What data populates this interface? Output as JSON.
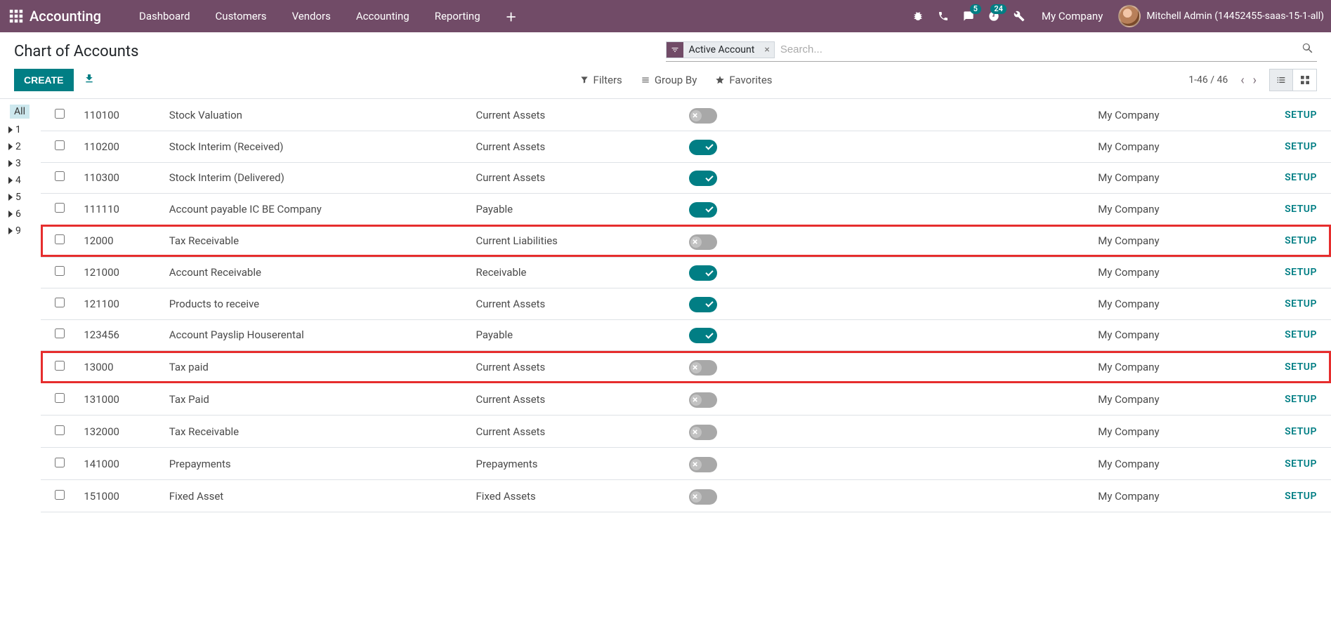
{
  "nav": {
    "app_title": "Accounting",
    "items": [
      "Dashboard",
      "Customers",
      "Vendors",
      "Accounting",
      "Reporting"
    ],
    "badges": {
      "messages": "5",
      "activities": "24"
    },
    "company": "My Company",
    "user": "Mitchell Admin (14452455-saas-15-1-all)"
  },
  "cp": {
    "title": "Chart of Accounts",
    "search_facet": "Active Account",
    "search_placeholder": "Search...",
    "create": "CREATE",
    "filters": "Filters",
    "groupby": "Group By",
    "favorites": "Favorites",
    "pager": "1-46 / 46"
  },
  "tree": {
    "all": "All",
    "nodes": [
      "1",
      "2",
      "3",
      "4",
      "5",
      "6",
      "9"
    ]
  },
  "table": {
    "setup_label": "SETUP",
    "rows": [
      {
        "code": "110100",
        "name": "Stock Valuation",
        "type": "Current Assets",
        "on": false,
        "company": "My Company",
        "hl": false
      },
      {
        "code": "110200",
        "name": "Stock Interim (Received)",
        "type": "Current Assets",
        "on": true,
        "company": "My Company",
        "hl": false
      },
      {
        "code": "110300",
        "name": "Stock Interim (Delivered)",
        "type": "Current Assets",
        "on": true,
        "company": "My Company",
        "hl": false
      },
      {
        "code": "111110",
        "name": "Account payable IC BE Company",
        "type": "Payable",
        "on": true,
        "company": "My Company",
        "hl": false
      },
      {
        "code": "12000",
        "name": "Tax Receivable",
        "type": "Current Liabilities",
        "on": false,
        "company": "My Company",
        "hl": true
      },
      {
        "code": "121000",
        "name": "Account Receivable",
        "type": "Receivable",
        "on": true,
        "company": "My Company",
        "hl": false
      },
      {
        "code": "121100",
        "name": "Products to receive",
        "type": "Current Assets",
        "on": true,
        "company": "My Company",
        "hl": false
      },
      {
        "code": "123456",
        "name": "Account Payslip Houserental",
        "type": "Payable",
        "on": true,
        "company": "My Company",
        "hl": false
      },
      {
        "code": "13000",
        "name": "Tax paid",
        "type": "Current Assets",
        "on": false,
        "company": "My Company",
        "hl": true
      },
      {
        "code": "131000",
        "name": "Tax Paid",
        "type": "Current Assets",
        "on": false,
        "company": "My Company",
        "hl": false
      },
      {
        "code": "132000",
        "name": "Tax Receivable",
        "type": "Current Assets",
        "on": false,
        "company": "My Company",
        "hl": false
      },
      {
        "code": "141000",
        "name": "Prepayments",
        "type": "Prepayments",
        "on": false,
        "company": "My Company",
        "hl": false
      },
      {
        "code": "151000",
        "name": "Fixed Asset",
        "type": "Fixed Assets",
        "on": false,
        "company": "My Company",
        "hl": false
      }
    ]
  }
}
